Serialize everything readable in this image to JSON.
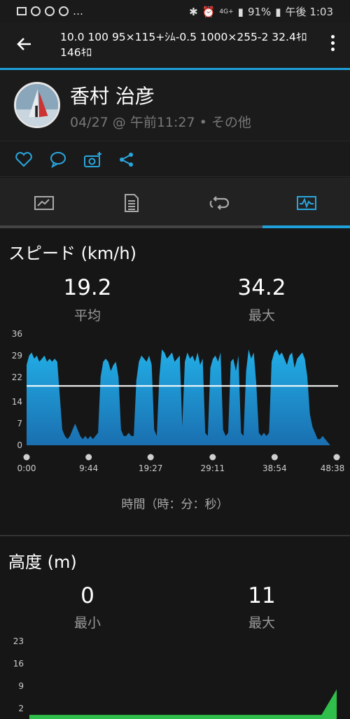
{
  "status_bar": {
    "battery": "91%",
    "time": "午後 1:03",
    "net": "4G+"
  },
  "app_bar": {
    "title": "10.0 100 95×115+ｼﾑ-0.5 1000×255-2 32.4ｷﾛ 146ｷﾛ"
  },
  "profile": {
    "name": "香村 治彦",
    "meta": "04/27 @ 午前11:27 • その他"
  },
  "actions": [
    "heart-icon",
    "comment-icon",
    "camera-add-icon",
    "share-icon"
  ],
  "tabs": [
    "overview-tab",
    "details-tab",
    "laps-tab",
    "charts-tab"
  ],
  "speed": {
    "title": "スピード (km/h)",
    "avg_value": "19.2",
    "avg_label": "平均",
    "max_value": "34.2",
    "max_label": "最大",
    "x_axis_title": "時間（時：分：秒）"
  },
  "altitude": {
    "title": "高度 (m)",
    "min_value": "0",
    "min_label": "最小",
    "max_value": "11",
    "max_label": "最大"
  },
  "chart_data": [
    {
      "type": "area",
      "title": "スピード (km/h)",
      "xlabel": "時間（時：分：秒）",
      "ylabel": "",
      "ylim": [
        0,
        36
      ],
      "y_ticks": [
        "0",
        "7",
        "14",
        "22",
        "29",
        "36"
      ],
      "x_ticks": [
        "0:00",
        "9:44",
        "19:27",
        "29:11",
        "38:54",
        "48:38"
      ],
      "average": 19.2,
      "x_minutes": [
        0.0,
        0.4,
        0.8,
        1.2,
        1.6,
        2.0,
        2.4,
        2.8,
        3.2,
        3.6,
        4.0,
        4.4,
        4.8,
        5.2,
        5.6,
        6.0,
        6.4,
        6.8,
        7.2,
        7.6,
        8.0,
        8.4,
        8.8,
        9.2,
        9.6,
        10.0,
        10.4,
        10.8,
        11.2,
        11.6,
        12.0,
        12.4,
        12.8,
        13.2,
        13.6,
        14.0,
        14.4,
        14.8,
        15.2,
        15.6,
        16.0,
        16.4,
        16.8,
        17.2,
        17.6,
        18.0,
        18.4,
        18.8,
        19.2,
        19.6,
        20.0,
        20.4,
        20.8,
        21.2,
        21.6,
        22.0,
        22.4,
        22.8,
        23.2,
        23.6,
        24.0,
        24.4,
        24.8,
        25.2,
        25.6,
        26.0,
        26.4,
        26.8,
        27.2,
        27.6,
        28.0,
        28.4,
        28.8,
        29.2,
        29.6,
        30.0,
        30.4,
        30.8,
        31.2,
        31.6,
        32.0,
        32.4,
        32.8,
        33.2,
        33.6,
        34.0,
        34.4,
        34.8,
        35.2,
        35.6,
        36.0,
        36.4,
        36.8,
        37.2,
        37.6,
        38.0,
        38.4,
        38.8,
        39.2,
        39.6,
        40.0,
        40.4,
        40.8,
        41.2,
        41.6,
        42.0,
        42.4,
        42.8,
        43.2,
        43.6,
        44.0,
        44.4,
        44.8,
        45.2,
        45.6,
        46.0,
        46.4,
        46.8,
        47.2,
        47.6,
        48.0,
        48.6
      ],
      "series": [
        {
          "values": [
            26,
            29,
            30,
            28,
            29,
            27,
            28,
            29,
            27,
            28,
            27,
            28,
            27,
            16,
            5,
            3,
            2,
            3,
            5,
            7,
            5,
            3,
            2,
            3,
            2,
            3,
            2,
            3,
            4,
            22,
            27,
            28,
            27,
            24,
            26,
            27,
            22,
            5,
            3,
            3,
            4,
            3,
            3,
            21,
            27,
            29,
            28,
            27,
            29,
            26,
            5,
            3,
            22,
            31,
            30,
            28,
            29,
            30,
            27,
            28,
            29,
            6,
            27,
            30,
            28,
            29,
            27,
            30,
            26,
            28,
            4,
            3,
            25,
            28,
            29,
            27,
            30,
            5,
            3,
            4,
            27,
            28,
            24,
            29,
            4,
            3,
            24,
            31,
            28,
            30,
            20,
            4,
            3,
            4,
            3,
            4,
            27,
            30,
            31,
            29,
            30,
            28,
            26,
            29,
            30,
            25,
            28,
            29,
            30,
            28,
            22,
            10,
            6,
            4,
            2,
            2,
            3,
            2,
            1,
            0
          ]
        }
      ]
    },
    {
      "type": "area",
      "title": "高度 (m)",
      "ylim": [
        0,
        23
      ],
      "y_ticks": [
        "2",
        "9",
        "16",
        "23"
      ],
      "x_minutes": [
        0,
        46.2,
        48.6
      ],
      "series": [
        {
          "values": [
            0,
            0,
            8
          ]
        }
      ]
    }
  ]
}
